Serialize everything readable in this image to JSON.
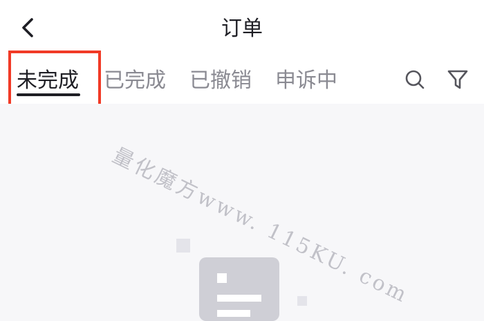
{
  "header": {
    "title": "订单",
    "back_icon": "chevron-left-icon"
  },
  "tabs": [
    {
      "label": "未完成",
      "active": true
    },
    {
      "label": "已完成",
      "active": false
    },
    {
      "label": "已撤销",
      "active": false
    },
    {
      "label": "申诉中",
      "active": false
    }
  ],
  "toolbar": {
    "search_icon": "search-icon",
    "filter_icon": "filter-icon"
  },
  "watermark": {
    "text": "量化魔方www. 115KU. com"
  },
  "colors": {
    "highlight": "#f13a26",
    "active_text": "#1e1e24",
    "inactive_text": "#8a8a92",
    "content_bg": "#f7f7f9"
  }
}
